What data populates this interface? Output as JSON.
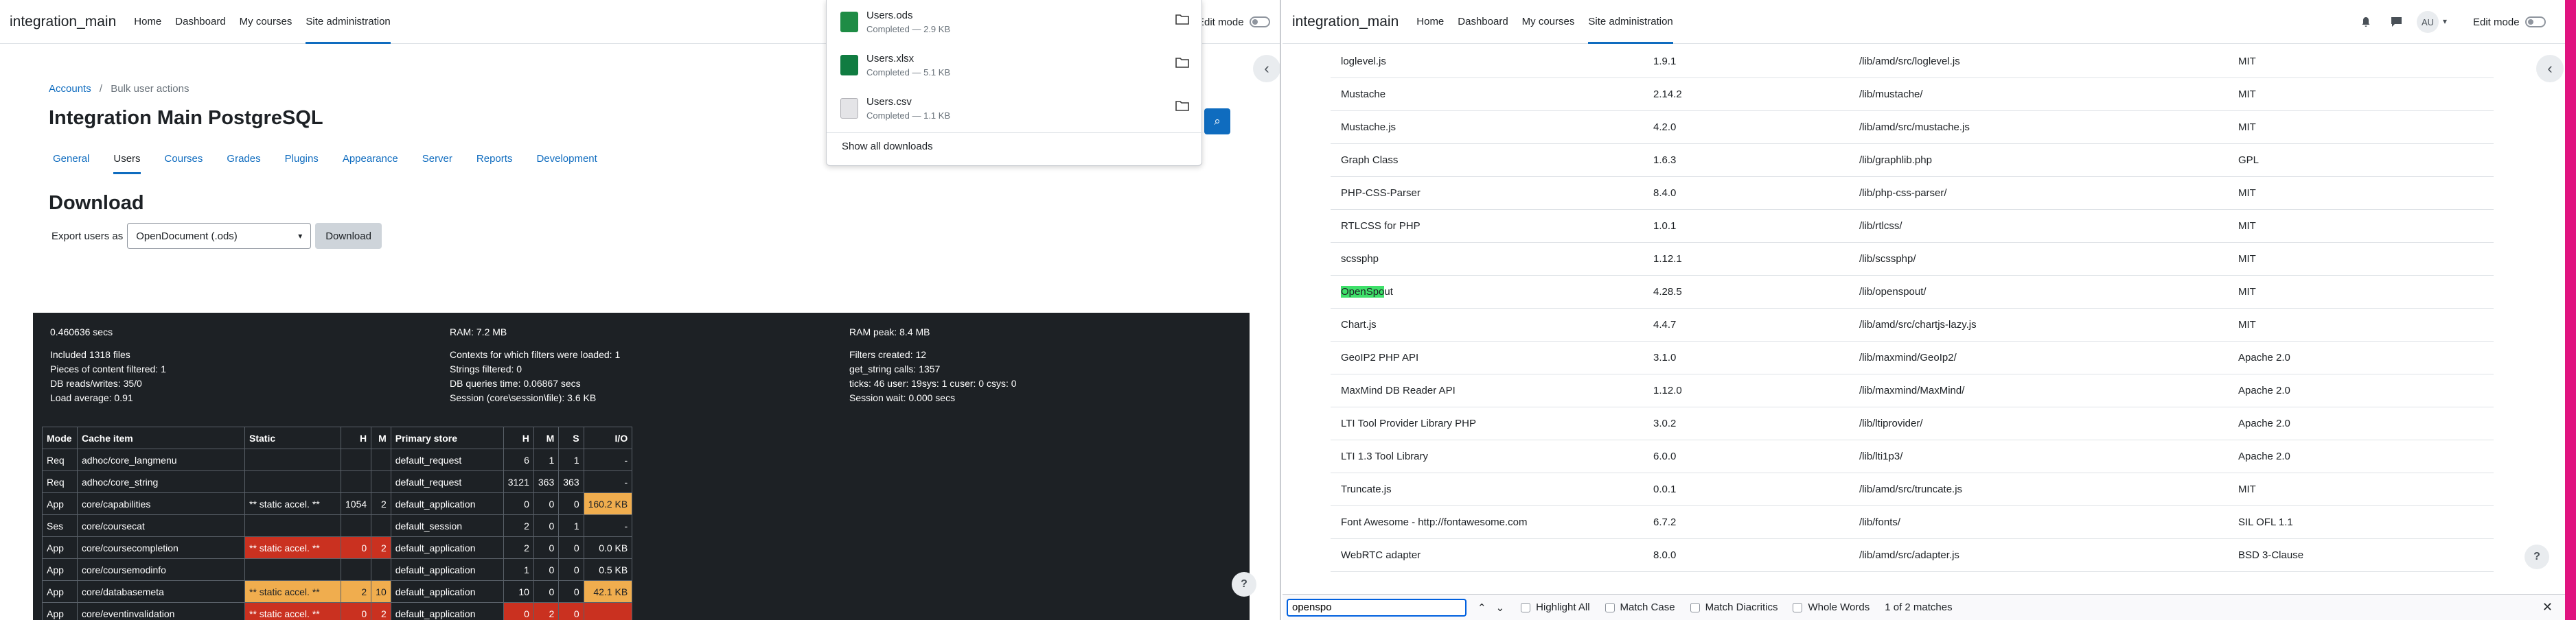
{
  "left": {
    "nav": {
      "brand": "integration_main",
      "links": [
        "Home",
        "Dashboard",
        "My courses",
        "Site administration"
      ],
      "edit_mode": "Edit mode"
    },
    "breadcrumb": {
      "accounts": "Accounts",
      "separator": "/",
      "current": "Bulk user actions"
    },
    "page_title": "Integration Main PostgreSQL",
    "tabs": [
      "General",
      "Users",
      "Courses",
      "Grades",
      "Plugins",
      "Appearance",
      "Server",
      "Reports",
      "Development"
    ],
    "active_tab": "Users",
    "section_title": "Download",
    "export": {
      "label": "Export users as",
      "selected": "OpenDocument (.ods)",
      "button": "Download"
    },
    "perf": {
      "col1": [
        "0.460636 secs",
        "Included 1318 files",
        "Pieces of content filtered: 1",
        "DB reads/writes: 35/0",
        "Load average: 0.91"
      ],
      "col2": [
        "RAM: 7.2 MB",
        "Contexts for which filters were loaded: 1",
        "Strings filtered: 0",
        "DB queries time: 0.06867 secs",
        "Session (core\\session\\file): 3.6 KB"
      ],
      "col3": [
        "RAM peak: 8.4 MB",
        "Filters created: 12",
        "get_string calls: 1357",
        "ticks: 46 user: 19sys: 1 cuser: 0 csys: 0",
        "Session wait: 0.000 secs"
      ]
    },
    "cache_table": {
      "headers": [
        "Mode",
        "Cache item",
        "Static",
        "H",
        "M",
        "Primary store",
        "H",
        "M",
        "S",
        "I/O"
      ],
      "rows": [
        [
          "Req",
          "adhoc/core_langmenu",
          "",
          "",
          "",
          "default_request",
          "6",
          "1",
          "1",
          "-"
        ],
        [
          "Req",
          "adhoc/core_string",
          "",
          "",
          "",
          "default_request",
          "3121",
          "363",
          "363",
          "-"
        ],
        [
          "App",
          "core/capabilities",
          "** static accel. **",
          "1054",
          "2",
          "default_application",
          "0",
          "0",
          "0",
          "160.2 KB"
        ],
        [
          "Ses",
          "core/coursecat",
          "",
          "",
          "",
          "default_session",
          "2",
          "0",
          "1",
          "-"
        ],
        [
          "App",
          "core/coursecompletion",
          "** static accel. **",
          "0",
          "2",
          "default_application",
          "2",
          "0",
          "0",
          "0.0 KB"
        ],
        [
          "App",
          "core/coursemodinfo",
          "",
          "",
          "",
          "default_application",
          "1",
          "0",
          "0",
          "0.5 KB"
        ],
        [
          "App",
          "core/databasemeta",
          "** static accel. **",
          "2",
          "10",
          "default_application",
          "10",
          "0",
          "0",
          "42.1 KB"
        ],
        [
          "App",
          "core/eventinvalidation",
          "** static accel. **",
          "0",
          "2",
          "default_application",
          "0",
          "2",
          "0",
          ""
        ]
      ]
    },
    "downloads": {
      "items": [
        {
          "name": "Users.ods",
          "status": "Completed — 2.9 KB",
          "icon": "ods-file-icon",
          "color": "#1e8c45"
        },
        {
          "name": "Users.xlsx",
          "status": "Completed — 5.1 KB",
          "icon": "xlsx-file-icon",
          "color": "#107c41"
        },
        {
          "name": "Users.csv",
          "status": "Completed — 1.1 KB",
          "icon": "csv-file-icon",
          "color": "#e4e4e7"
        }
      ],
      "show_all": "Show all downloads"
    },
    "help": "?"
  },
  "right": {
    "nav": {
      "brand": "integration_main",
      "links": [
        "Home",
        "Dashboard",
        "My courses",
        "Site administration"
      ],
      "avatar": "AU",
      "edit_mode": "Edit mode"
    },
    "rows": [
      [
        "loglevel.js",
        "1.9.1",
        "/lib/amd/src/loglevel.js",
        "MIT"
      ],
      [
        "Mustache",
        "2.14.2",
        "/lib/mustache/",
        "MIT"
      ],
      [
        "Mustache.js",
        "4.2.0",
        "/lib/amd/src/mustache.js",
        "MIT"
      ],
      [
        "Graph Class",
        "1.6.3",
        "/lib/graphlib.php",
        "GPL"
      ],
      [
        "PHP-CSS-Parser",
        "8.4.0",
        "/lib/php-css-parser/",
        "MIT"
      ],
      [
        "RTLCSS for PHP",
        "1.0.1",
        "/lib/rtlcss/",
        "MIT"
      ],
      [
        "scssphp",
        "1.12.1",
        "/lib/scssphp/",
        "MIT"
      ],
      [
        "OpenSpout",
        "4.28.5",
        "/lib/openspout/",
        "MIT"
      ],
      [
        "Chart.js",
        "4.4.7",
        "/lib/amd/src/chartjs-lazy.js",
        "MIT"
      ],
      [
        "GeoIP2 PHP API",
        "3.1.0",
        "/lib/maxmind/GeoIp2/",
        "Apache 2.0"
      ],
      [
        "MaxMind DB Reader API",
        "1.12.0",
        "/lib/maxmind/MaxMind/",
        "Apache 2.0"
      ],
      [
        "LTI Tool Provider Library PHP",
        "3.0.2",
        "/lib/ltiprovider/",
        "Apache 2.0"
      ],
      [
        "LTI 1.3 Tool Library",
        "6.0.0",
        "/lib/lti1p3/",
        "Apache 2.0"
      ],
      [
        "Truncate.js",
        "0.0.1",
        "/lib/amd/src/truncate.js",
        "MIT"
      ],
      [
        "Font Awesome - http://fontawesome.com",
        "6.7.2",
        "/lib/fonts/",
        "SIL OFL 1.1"
      ],
      [
        "WebRTC adapter",
        "8.0.0",
        "/lib/amd/src/adapter.js",
        "BSD 3-Clause"
      ]
    ],
    "find": {
      "value": "openspo",
      "highlight_all": "Highlight All",
      "match_case": "Match Case",
      "match_diacritics": "Match Diacritics",
      "whole_words": "Whole Words",
      "status": "1 of 2 matches"
    },
    "help": "?"
  },
  "colors": {
    "accent": "#0f6cbf",
    "find_highlight": "#3ee06a",
    "perf_bg": "#1d2125",
    "static_red": "#ca3120",
    "io_amber": "#f0ad4e",
    "edge_stripe": "#e0137f"
  }
}
